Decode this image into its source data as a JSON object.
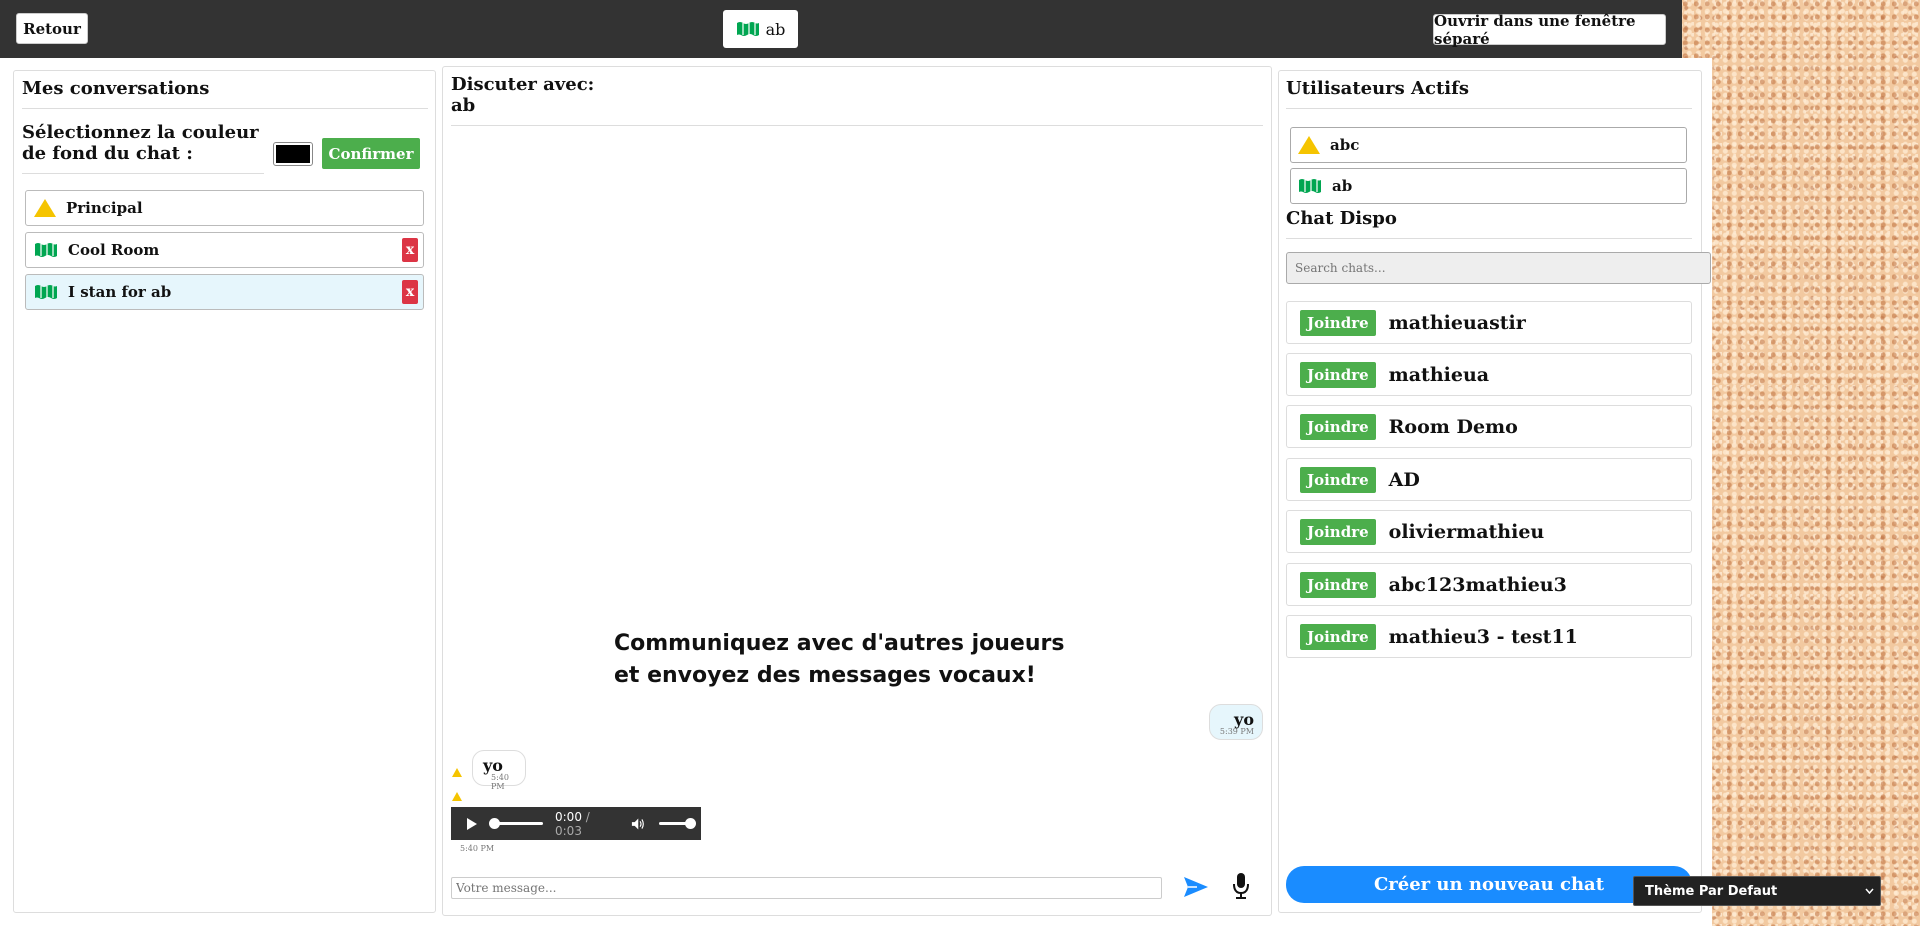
{
  "header": {
    "back_label": "Retour",
    "current_user": "ab",
    "open_window_label": "Ouvrir dans une fenêtre séparé"
  },
  "left": {
    "title": "Mes conversations",
    "color_label": "Sélectionnez la couleur de fond du chat :",
    "color_value": "#000000",
    "confirm_label": "Confirmer",
    "conversations": [
      {
        "label": "Principal",
        "icon": "warning-triangle-icon",
        "removable": false,
        "active": false
      },
      {
        "label": "Cool Room",
        "icon": "green-wave-icon",
        "removable": true,
        "active": false
      },
      {
        "label": "I stan for ab",
        "icon": "green-wave-icon",
        "removable": true,
        "active": true
      }
    ],
    "remove_label": "x"
  },
  "center": {
    "title_line1": "Discuter avec:",
    "title_line2": "ab",
    "promo": "Communiquez avec d'autres joueurs et envoyez des messages vocaux!",
    "messages": [
      {
        "text": "yo",
        "time": "5:39 PM",
        "mine": true
      },
      {
        "text": "yo",
        "time": "5:40 PM",
        "mine": false
      },
      {
        "audio": true,
        "current": "0:00",
        "duration": "0:03",
        "time": "5:40 PM",
        "mine": false
      }
    ],
    "audio_sep": "/",
    "input_placeholder": "Votre message..."
  },
  "right": {
    "active_title": "Utilisateurs Actifs",
    "active_users": [
      {
        "name": "abc",
        "icon": "warning-triangle-icon"
      },
      {
        "name": "ab",
        "icon": "green-wave-icon"
      }
    ],
    "dispo_title": "Chat Dispo",
    "search_placeholder": "Search chats...",
    "join_label": "Joindre",
    "chats": [
      "mathieuastir",
      "mathieua",
      "Room Demo",
      "AD",
      "oliviermathieu",
      "abc123mathieu3",
      "mathieu3 - test11"
    ],
    "create_label": "Créer un nouveau chat"
  },
  "theme": {
    "selected": "Thème Par Defaut"
  },
  "colors": {
    "accent_green": "#4cae4c",
    "danger": "#dc3545",
    "primary_blue": "#1a8cff",
    "topbar": "#333333"
  }
}
